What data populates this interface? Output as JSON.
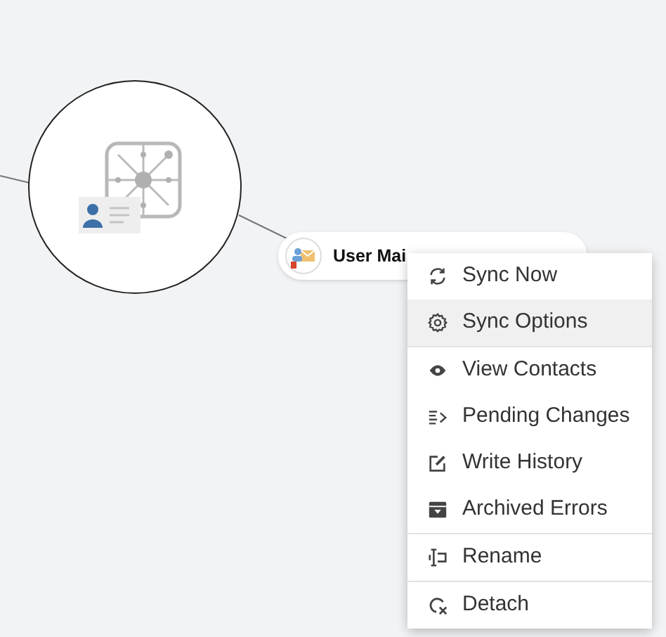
{
  "node": {
    "label": "User Mai"
  },
  "context_menu": {
    "groups": [
      {
        "items": [
          {
            "label": "Sync Now",
            "selected": false
          },
          {
            "label": "Sync Options",
            "selected": true
          }
        ]
      },
      {
        "items": [
          {
            "label": "View Contacts",
            "selected": false
          },
          {
            "label": "Pending Changes",
            "selected": false
          },
          {
            "label": "Write History",
            "selected": false
          },
          {
            "label": "Archived Errors",
            "selected": false
          }
        ]
      },
      {
        "items": [
          {
            "label": "Rename",
            "selected": false
          }
        ]
      },
      {
        "items": [
          {
            "label": "Detach",
            "selected": false
          }
        ]
      }
    ]
  }
}
